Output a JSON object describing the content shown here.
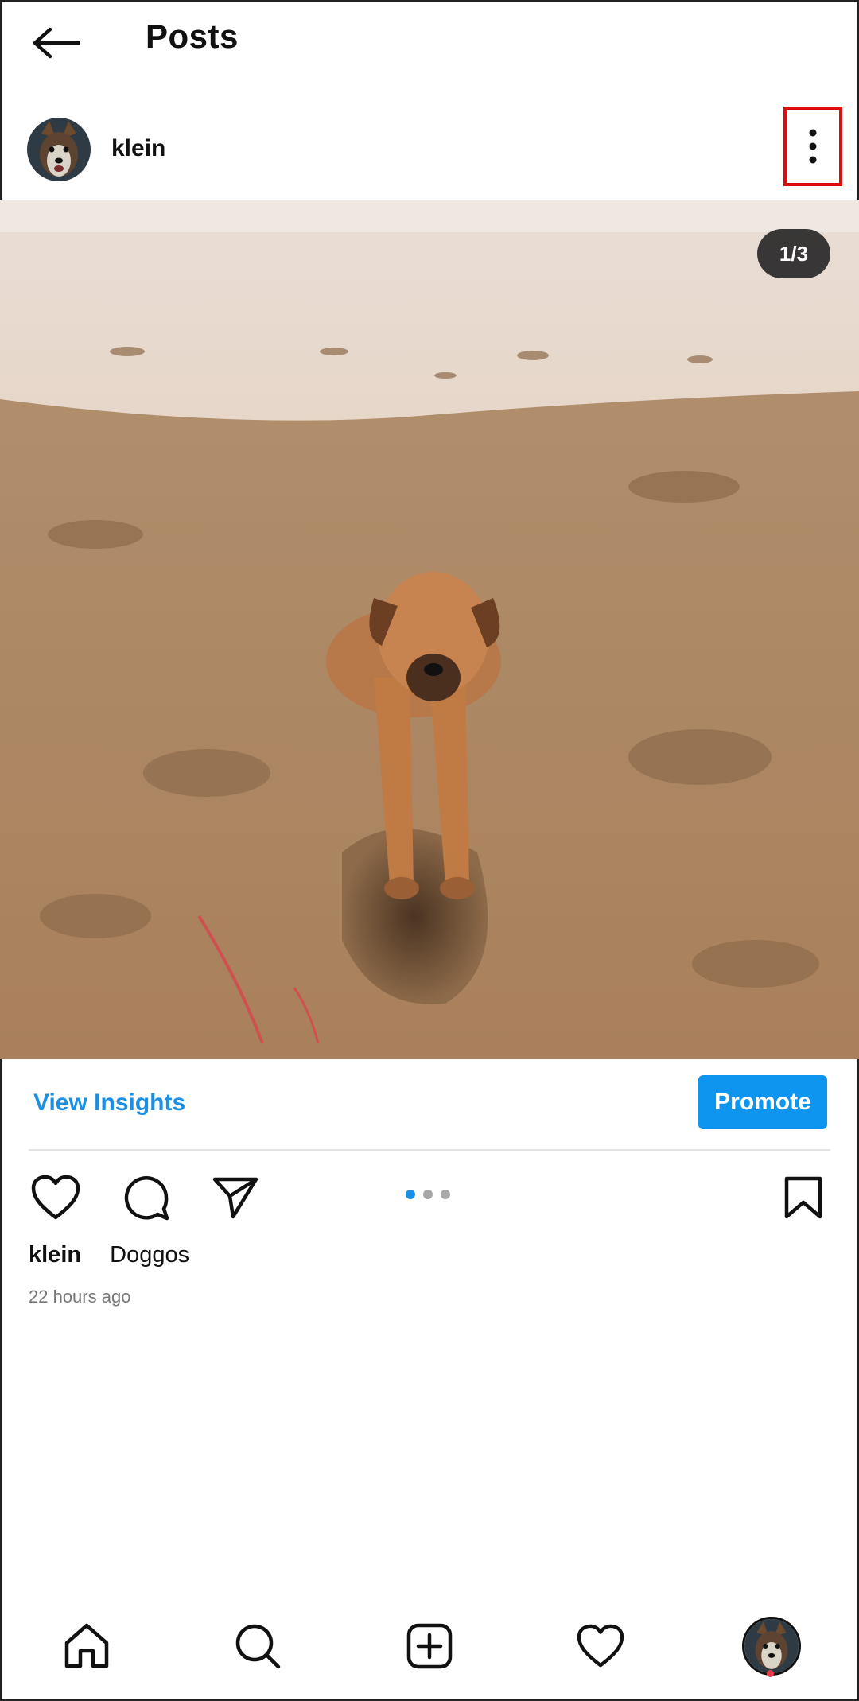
{
  "header": {
    "title": "Posts"
  },
  "post": {
    "username": "klein",
    "media_counter": "1/3",
    "caption_user": "klein",
    "caption_text": "Doggos",
    "timestamp": "22 hours ago"
  },
  "insights": {
    "view_label": "View Insights",
    "promote_label": "Promote"
  },
  "carousel": {
    "total": 3,
    "active_index": 0
  },
  "icons": {
    "back": "arrow-left-icon",
    "more": "more-vertical-icon",
    "like": "heart-icon",
    "comment": "comment-icon",
    "share": "send-icon",
    "save": "bookmark-icon",
    "nav": [
      "home-icon",
      "search-icon",
      "add-icon",
      "heart-icon",
      "profile-avatar"
    ]
  },
  "colors": {
    "accent": "#0e95f0",
    "link": "#1a8fe3",
    "highlight_box": "#e10b0b",
    "notification_dot": "#e33b4a"
  }
}
